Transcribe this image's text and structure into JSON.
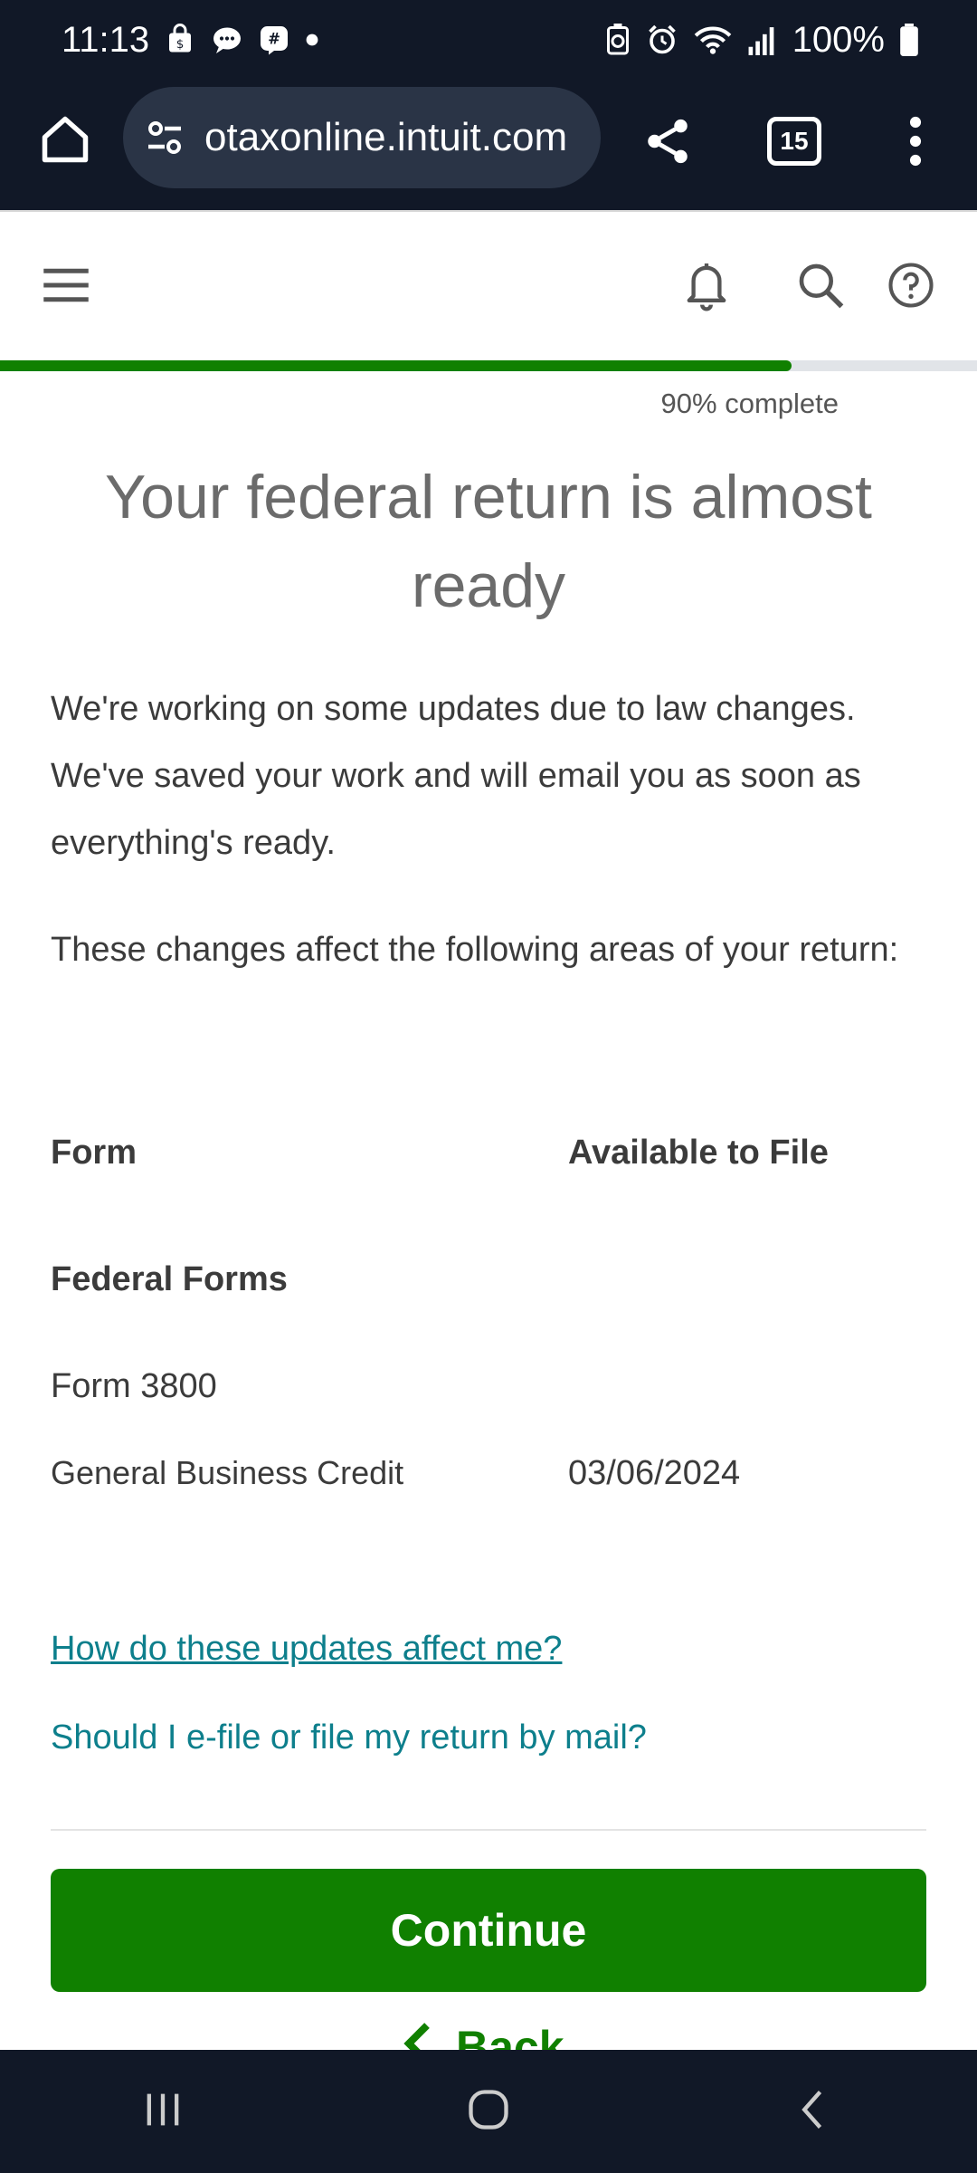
{
  "status_bar": {
    "time": "11:13",
    "battery": "100%"
  },
  "browser": {
    "url": "otaxonline.intuit.com",
    "tab_count": "15"
  },
  "progress": {
    "value": 0.9,
    "label": "90% complete"
  },
  "main": {
    "title": "Your federal return is almost ready",
    "paragraph1": "We're working on some updates due to law changes. We've saved your work and will email you as soon as everything's ready.",
    "paragraph2": "These changes affect the following areas of your return:",
    "table": {
      "header_form": "Form",
      "header_available": "Available to File",
      "section": "Federal Forms",
      "rows": [
        {
          "name": "Form 3800",
          "date": ""
        },
        {
          "name": "General Business Credit",
          "date": "03/06/2024"
        }
      ]
    },
    "link1": "How do these updates affect me?",
    "link2": "Should I e-file or file my return by mail?",
    "continue_label": "Continue",
    "back_label": "Back"
  },
  "colors": {
    "accent_green": "#108000",
    "link_teal": "#0d7f8c",
    "dark_bar": "#111827"
  }
}
